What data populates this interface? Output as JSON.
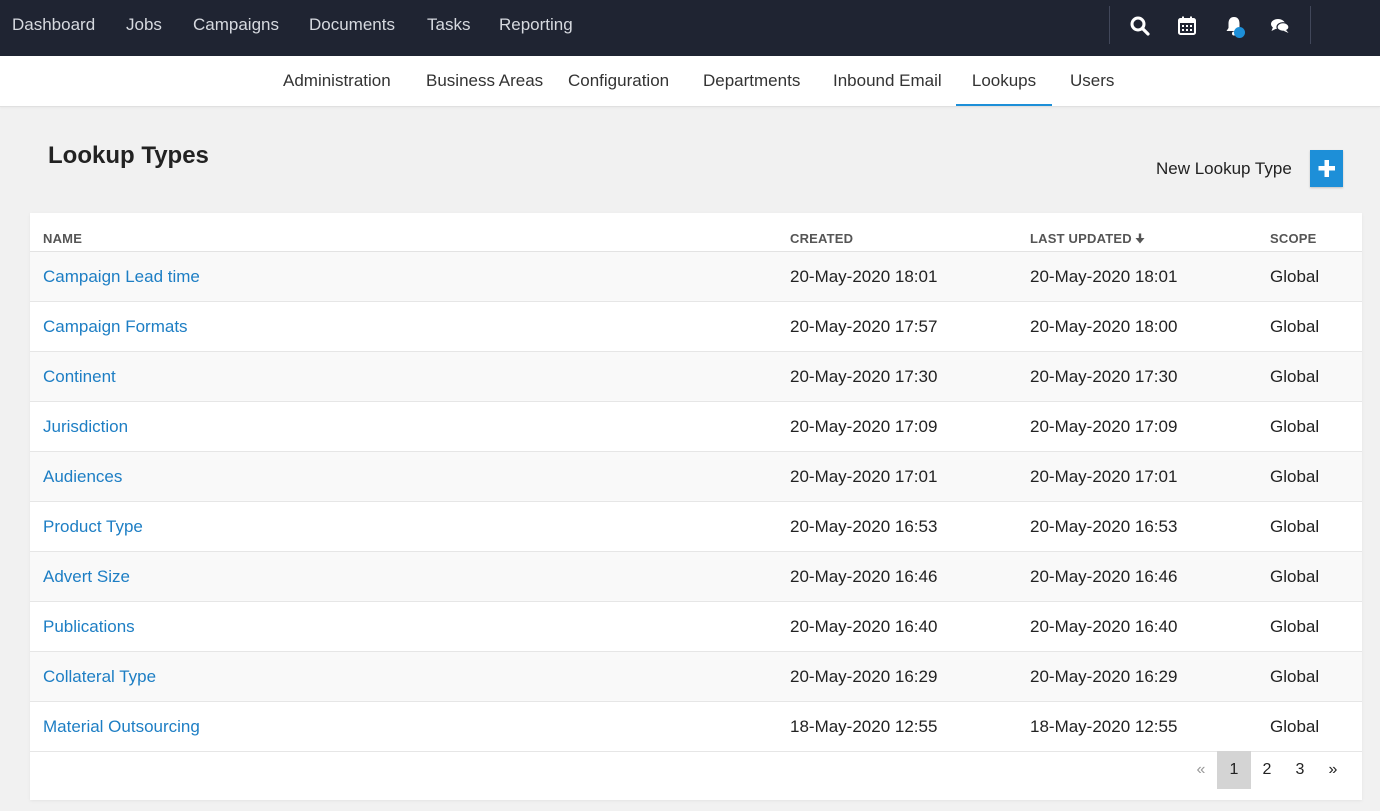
{
  "topnav": {
    "links": [
      "Dashboard",
      "Jobs",
      "Campaigns",
      "Documents",
      "Tasks",
      "Reporting"
    ],
    "icons": [
      "search-icon",
      "calendar-icon",
      "bell-icon",
      "chat-icon"
    ],
    "notification_dot_color": "#1d8fd8",
    "background": "#1f2432"
  },
  "subnav": {
    "links": [
      "Administration",
      "Business Areas",
      "Configuration",
      "Departments",
      "Inbound Email",
      "Lookups",
      "Users"
    ],
    "active": "Lookups"
  },
  "page": {
    "title": "Lookup Types",
    "new_label": "New Lookup Type",
    "accent_color": "#1d8fd8",
    "link_color": "#1d7ec4"
  },
  "table": {
    "columns": {
      "name": "NAME",
      "created": "CREATED",
      "updated": "LAST UPDATED",
      "scope": "SCOPE"
    },
    "sort": {
      "column": "updated",
      "direction": "desc",
      "icon": "arrow-down-icon"
    },
    "rows": [
      {
        "name": "Campaign Lead time",
        "created": "20-May-2020 18:01",
        "updated": "20-May-2020 18:01",
        "scope": "Global"
      },
      {
        "name": "Campaign Formats",
        "created": "20-May-2020 17:57",
        "updated": "20-May-2020 18:00",
        "scope": "Global"
      },
      {
        "name": "Continent",
        "created": "20-May-2020 17:30",
        "updated": "20-May-2020 17:30",
        "scope": "Global"
      },
      {
        "name": "Jurisdiction",
        "created": "20-May-2020 17:09",
        "updated": "20-May-2020 17:09",
        "scope": "Global"
      },
      {
        "name": "Audiences",
        "created": "20-May-2020 17:01",
        "updated": "20-May-2020 17:01",
        "scope": "Global"
      },
      {
        "name": "Product Type",
        "created": "20-May-2020 16:53",
        "updated": "20-May-2020 16:53",
        "scope": "Global"
      },
      {
        "name": "Advert Size",
        "created": "20-May-2020 16:46",
        "updated": "20-May-2020 16:46",
        "scope": "Global"
      },
      {
        "name": "Publications",
        "created": "20-May-2020 16:40",
        "updated": "20-May-2020 16:40",
        "scope": "Global"
      },
      {
        "name": "Collateral Type",
        "created": "20-May-2020 16:29",
        "updated": "20-May-2020 16:29",
        "scope": "Global"
      },
      {
        "name": "Material Outsourcing",
        "created": "18-May-2020 12:55",
        "updated": "18-May-2020 12:55",
        "scope": "Global"
      }
    ]
  },
  "pagination": {
    "prev": "«",
    "pages": [
      "1",
      "2",
      "3"
    ],
    "current": "1",
    "next": "»"
  }
}
